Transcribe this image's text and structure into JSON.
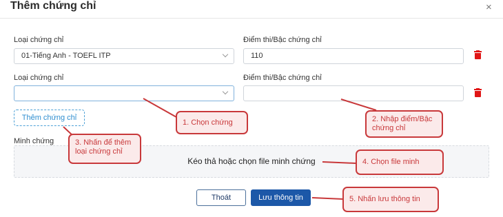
{
  "dialog": {
    "title": "Thêm chứng chỉ",
    "close": "×"
  },
  "rows": [
    {
      "type_label": "Loại chứng chỉ",
      "type_value": "01-Tiếng Anh - TOEFL ITP",
      "score_label": "Điểm thi/Bậc chứng chỉ",
      "score_value": "110"
    },
    {
      "type_label": "Loại chứng chỉ",
      "type_value": "",
      "score_label": "Điểm thi/Bậc chứng chỉ",
      "score_value": ""
    }
  ],
  "add_button": "Thêm chứng chỉ",
  "evidence": {
    "label": "Minh chứng",
    "dropzone_text": "Kéo thả hoặc chọn file minh chứng"
  },
  "buttons": {
    "exit": "Thoát",
    "save": "Lưu thông tin"
  },
  "callouts": {
    "c1": "1. Chọn chứng",
    "c2_line1": "2. Nhập điểm/Bậc",
    "c2_line2": "chứng chỉ",
    "c3_line1": "3. Nhấn để thêm",
    "c3_line2": "loại chứng chỉ",
    "c4": "4. Chọn file minh",
    "c5": "5. Nhấn lưu thông tin"
  },
  "colors": {
    "accent": "#1c58a8",
    "link": "#2f8ed0",
    "danger": "#e01515",
    "callout_border": "#c8383a",
    "callout_bg": "#fbeaea"
  }
}
